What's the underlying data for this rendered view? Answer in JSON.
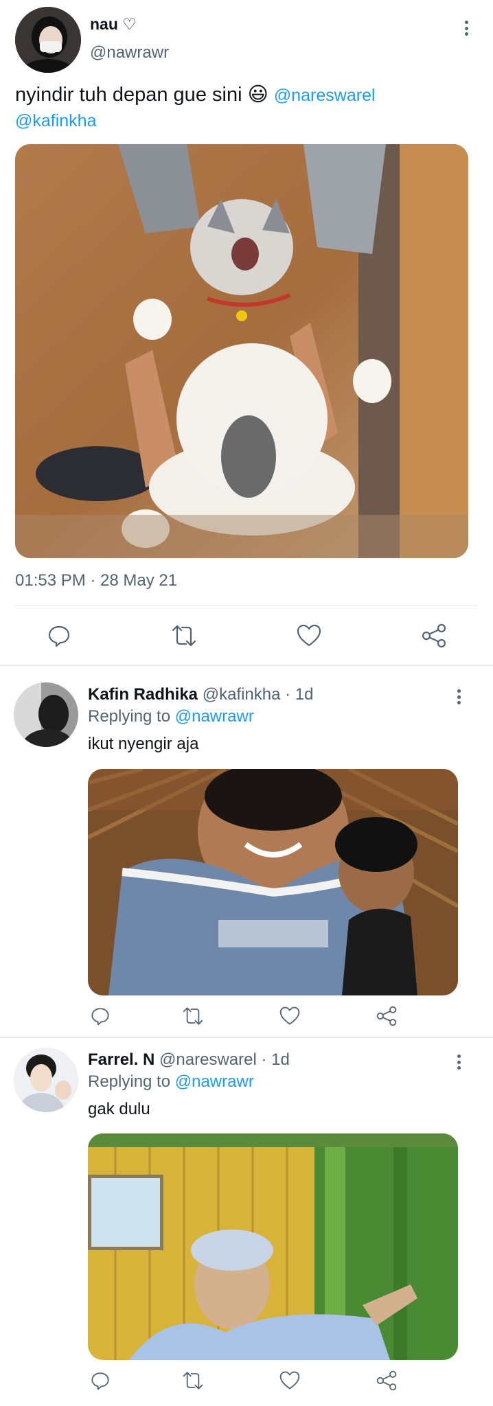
{
  "main_tweet": {
    "display_name": "nau ♡",
    "handle": "@nawrawr",
    "text": "nyindir tuh depan gue sini 😃",
    "mention_1": "@nareswarel",
    "mention_2": "@kafinkha",
    "timestamp": "01:53 PM · 28 May 21",
    "media_description": "cat photo"
  },
  "replies": [
    {
      "display_name": "Kafin Radhika",
      "handle": "@kafinkha",
      "time": "· 1d",
      "replying_label": "Replying to",
      "replying_to": "@nawrawr",
      "text": "ikut nyengir aja"
    },
    {
      "display_name": "Farrel. N",
      "handle": "@nareswarel",
      "time": "· 1d",
      "replying_label": "Replying to",
      "replying_to": "@nawrawr",
      "text": "gak dulu"
    }
  ],
  "icons": [
    "reply-icon",
    "retweet-icon",
    "like-icon",
    "share-icon",
    "more-icon"
  ],
  "colors": {
    "link": "#1d9bf0",
    "muted": "#536471",
    "divider": "#e6ecf0"
  }
}
